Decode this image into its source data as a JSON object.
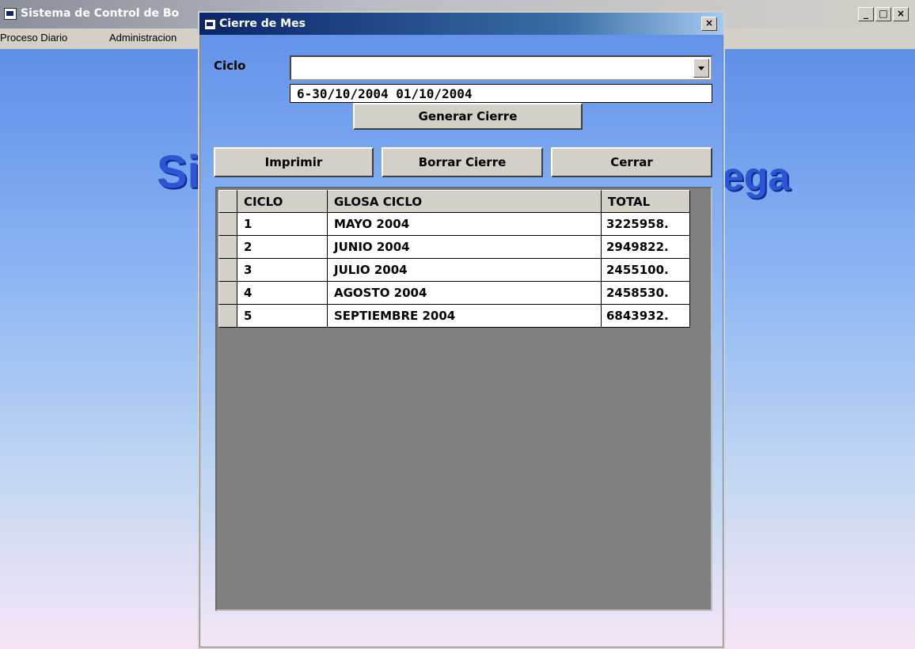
{
  "app": {
    "title": "Sistema de Control de Bo",
    "menu": [
      "Proceso Diario",
      "Administracion"
    ],
    "banner_left": "Si",
    "banner_right": "ega",
    "window_buttons": {
      "minimize": "_",
      "maximize": "□",
      "close": "×"
    }
  },
  "dialog": {
    "title": "Cierre de Mes",
    "close_glyph": "×",
    "ciclo_label": "Ciclo",
    "ciclo_value": "",
    "ciclo_option": "6-30/10/2004 01/10/2004",
    "generar_label": "Generar Cierre",
    "imprimir_label": "Imprimir",
    "borrar_label": "Borrar Cierre",
    "cerrar_label": "Cerrar",
    "grid": {
      "headers": [
        "CICLO",
        "GLOSA CICLO",
        "TOTAL"
      ],
      "rows": [
        {
          "ciclo": "1",
          "glosa": "MAYO 2004",
          "total": "3225958."
        },
        {
          "ciclo": "2",
          "glosa": "JUNIO 2004",
          "total": "2949822."
        },
        {
          "ciclo": "3",
          "glosa": "JULIO 2004",
          "total": "2455100."
        },
        {
          "ciclo": "4",
          "glosa": "AGOSTO 2004",
          "total": "2458530."
        },
        {
          "ciclo": "5",
          "glosa": "SEPTIEMBRE 2004",
          "total": "6843932."
        }
      ]
    }
  }
}
